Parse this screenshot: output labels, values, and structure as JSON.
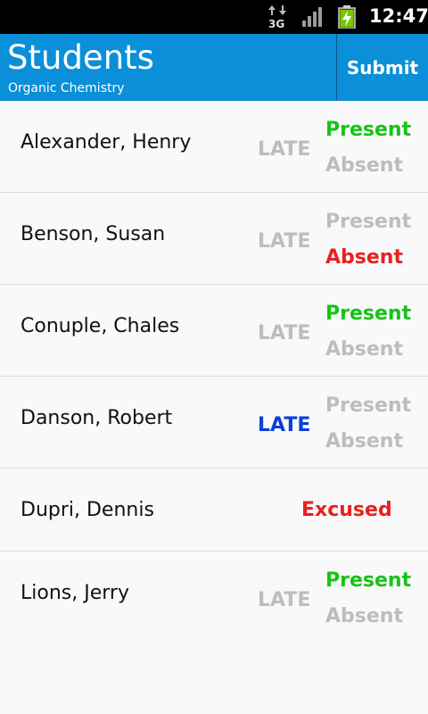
{
  "status_bar": {
    "time": "12:47",
    "network_label": "3G",
    "icons": [
      "data-3g-icon",
      "signal-icon",
      "battery-charging-icon"
    ]
  },
  "header": {
    "title": "Students",
    "subtitle": "Organic Chemistry",
    "submit_label": "Submit",
    "colors": {
      "background": "#0a8fd8",
      "divider": "#05568a"
    }
  },
  "colors": {
    "present_active": "#17c317",
    "absent_active": "#e82121",
    "late_active": "#0b3fd6",
    "inactive": "#bdbdbd",
    "excused": "#e82121"
  },
  "students": [
    {
      "name": "Alexander, Henry",
      "status": "present",
      "late_label": "LATE",
      "present_label": "Present",
      "absent_label": "Absent"
    },
    {
      "name": "Benson, Susan",
      "status": "absent",
      "late_label": "LATE",
      "present_label": "Present",
      "absent_label": "Absent"
    },
    {
      "name": "Conuple, Chales",
      "status": "present",
      "late_label": "LATE",
      "present_label": "Present",
      "absent_label": "Absent"
    },
    {
      "name": "Danson, Robert",
      "status": "late",
      "late_label": "LATE",
      "present_label": "Present",
      "absent_label": "Absent"
    },
    {
      "name": "Dupri, Dennis",
      "status": "excused",
      "excused_label": "Excused"
    },
    {
      "name": "Lions, Jerry",
      "status": "present",
      "late_label": "LATE",
      "present_label": "Present",
      "absent_label": "Absent"
    }
  ]
}
